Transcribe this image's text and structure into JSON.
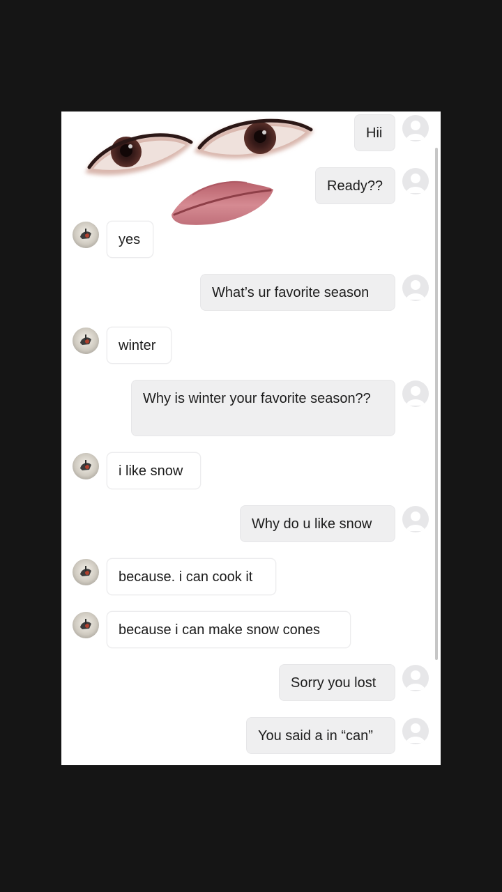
{
  "messages": [
    {
      "side": "out",
      "text": "Hii"
    },
    {
      "side": "out",
      "text": "Ready??"
    },
    {
      "side": "in",
      "text": "yes"
    },
    {
      "side": "out",
      "text": "What’s ur favorite season"
    },
    {
      "side": "in",
      "text": "winter"
    },
    {
      "side": "out",
      "text": "Why is winter your favorite season??"
    },
    {
      "side": "in",
      "text": "i like snow"
    },
    {
      "side": "out",
      "text": "Why do u like snow"
    },
    {
      "side": "in",
      "text": "because. i can cook it"
    },
    {
      "side": "in",
      "text": "because i can make snow cones"
    },
    {
      "side": "out",
      "text": "Sorry you lost"
    },
    {
      "side": "out",
      "text": "You said a in “can”"
    }
  ],
  "colors": {
    "page_background": "#151515",
    "panel_background": "#ffffff",
    "outgoing_bubble": "#efeff0",
    "incoming_bubble": "#ffffff",
    "text": "#1c1c1c",
    "default_avatar": "#e7e7e9"
  },
  "icons": {
    "outgoing_avatar": "default-user-avatar-icon",
    "incoming_avatar": "profile-photo-avatar"
  }
}
